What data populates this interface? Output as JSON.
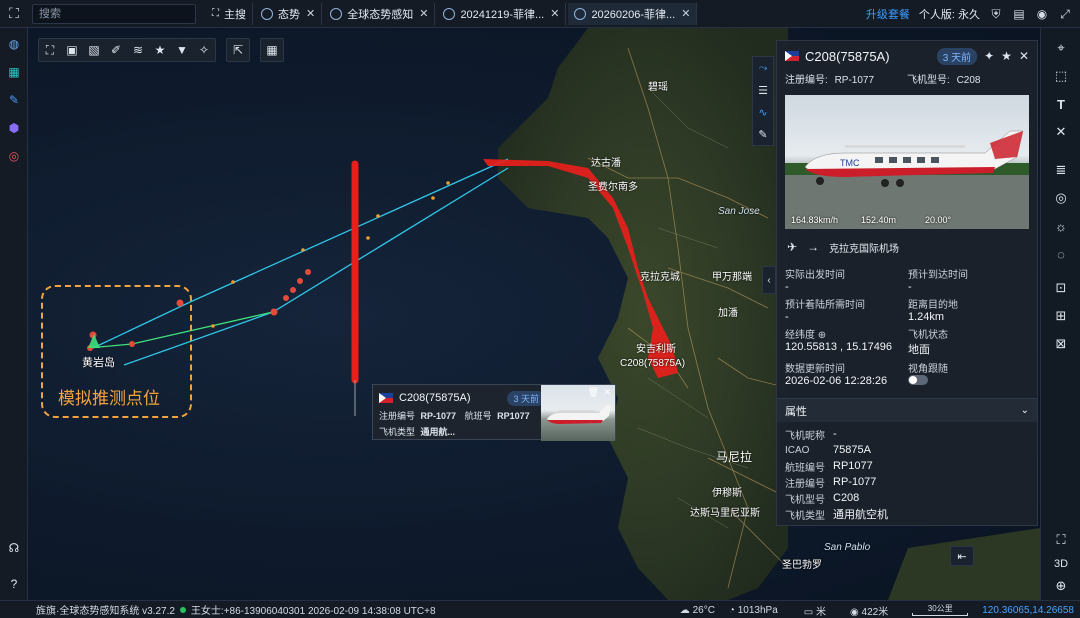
{
  "app": {
    "logo_icon": "scan-frame-icon"
  },
  "search": {
    "placeholder": "搜索"
  },
  "tabs": [
    {
      "label": "主搜",
      "icon": "home-icon"
    },
    {
      "label": "态势",
      "icon": "globe-icon"
    },
    {
      "label": "全球态势感知",
      "icon": "globe-icon"
    },
    {
      "label": "20241219-菲律...",
      "icon": "globe-icon"
    },
    {
      "label": "20260206-菲律...",
      "icon": "globe-icon"
    }
  ],
  "topright": {
    "upgrade": "升级套餐",
    "user": "个人版: 永久"
  },
  "map_labels": {
    "island": "黄岩岛",
    "annotation": "模拟推测点位",
    "places": [
      "碧瑶",
      "达古潘",
      "圣费尔南多",
      "San Jose",
      "克拉克城",
      "甲万那端",
      "加潘",
      "安吉利斯",
      "马尼拉",
      "伊穆斯",
      "达斯马里尼亚斯",
      "San Pablo",
      "圣巴勃罗"
    ],
    "plane_marker": "C208(75875A)"
  },
  "panel": {
    "title": "C208(75875A)",
    "badge": "3 天前",
    "reg_label": "注册编号:",
    "reg_value": "RP-1077",
    "type_label": "飞机型号:",
    "type_value": "C208",
    "photo_stats": {
      "speed": "164.83km/h",
      "altitude": "152.40m",
      "heading": "20.00°"
    },
    "destination": "克拉克国际机场",
    "fields": [
      {
        "label": "实际出发时间",
        "value": "-"
      },
      {
        "label": "预计到达时间",
        "value": "-"
      },
      {
        "label": "预计着陆所需时间",
        "value": "-"
      },
      {
        "label": "距离目的地",
        "value": "1.24km"
      },
      {
        "label": "经纬度",
        "value": "120.55813 , 15.17496"
      },
      {
        "label": "飞机状态",
        "value": "地面"
      },
      {
        "label": "数据更新时间",
        "value": "2026-02-06 12:28:26"
      },
      {
        "label": "视角跟随",
        "value": ""
      }
    ],
    "section": "属性",
    "props": [
      {
        "k": "飞机昵称",
        "v": "-"
      },
      {
        "k": "ICAO",
        "v": "75875A"
      },
      {
        "k": "航班编号",
        "v": "RP1077"
      },
      {
        "k": "注册编号",
        "v": "RP-1077"
      },
      {
        "k": "飞机型号",
        "v": "C208"
      },
      {
        "k": "飞机类型",
        "v": "通用航空机"
      }
    ]
  },
  "popup": {
    "title": "C208(75875A)",
    "badge": "3 天前",
    "reg_label": "注册编号",
    "reg_value": "RP-1077",
    "flight_label": "航班号",
    "flight_value": "RP1077",
    "type_label": "飞机类型",
    "type_value": "通用航..."
  },
  "statusbar": {
    "system": "旌旗·全球态势感知系统 v3.27.2",
    "user_info": "王女士:+86-13906040301 2026-02-09 14:38:08 UTC+8",
    "temp": "26°C",
    "pressure": "1013hPa",
    "unit": "米",
    "camera": "422米",
    "scale": "30公里",
    "coords": "120.36065,14.26658"
  },
  "rightrail": {
    "mode_3d": "3D"
  },
  "colors": {
    "accent": "#3b9dff",
    "track_red": "#e8201c",
    "track_cyan": "#2fc6e8",
    "track_green": "#3fe07a",
    "annot_orange": "#f5a33d"
  }
}
